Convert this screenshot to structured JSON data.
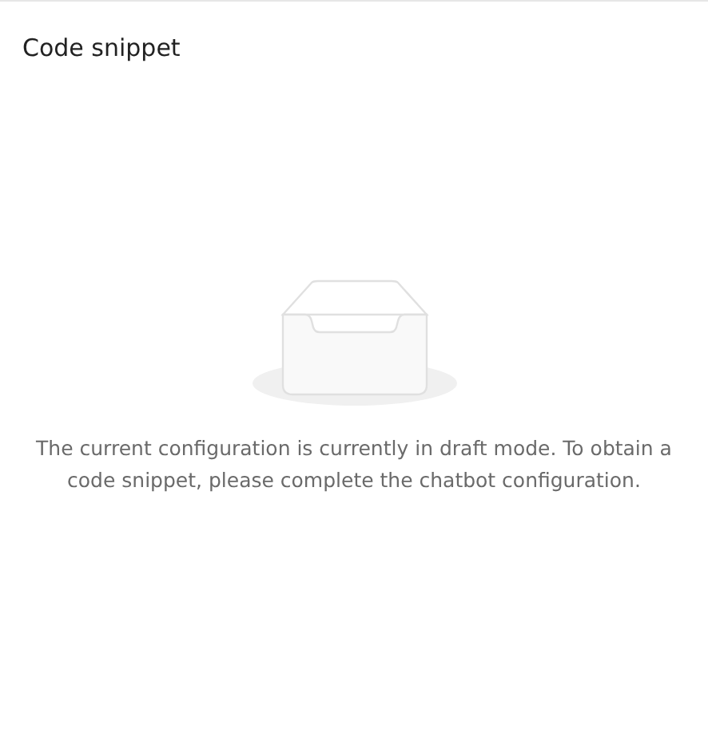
{
  "panel": {
    "title": "Code snippet"
  },
  "empty_state": {
    "message": "The current configuration is currently in draft mode. To obtain a code snippet, please complete the chatbot configuration."
  }
}
